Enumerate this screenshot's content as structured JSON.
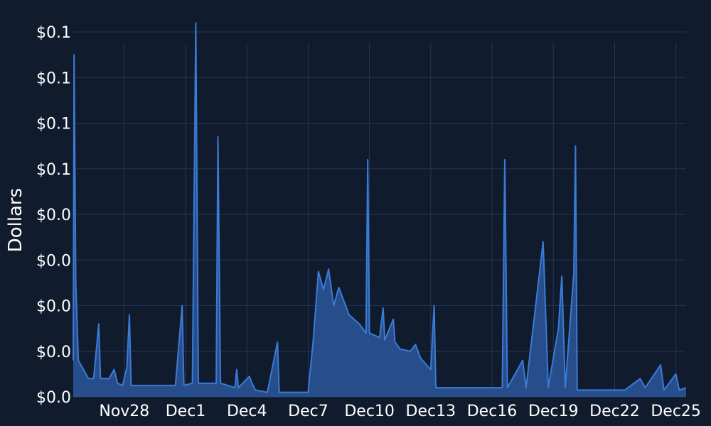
{
  "colors": {
    "background": "#111b2e",
    "grid": "#26365a",
    "line": "#3a7bd5",
    "fill": "#2b579a",
    "text": "#ffffff"
  },
  "chart_data": {
    "type": "area",
    "title": "",
    "xlabel": "",
    "ylabel": "Dollars",
    "grid": true,
    "legend": "none",
    "x_tick_labels": [
      "Nov28",
      "Dec1",
      "Dec4",
      "Dec7",
      "Dec10",
      "Dec13",
      "Dec16",
      "Dec19",
      "Dec22",
      "Dec25"
    ],
    "y_tick_labels": [
      "$0.0",
      "$0.0",
      "$0.0",
      "$0.0",
      "$0.0",
      "$0.1",
      "$0.1",
      "$0.1",
      "$0.1"
    ],
    "y_tick_values": [
      0,
      0.02,
      0.04,
      0.06,
      0.08,
      0.1,
      0.12,
      0.14,
      0.16
    ],
    "xlim": [
      "Nov 25 12:00",
      "Dec 25 12:00"
    ],
    "ylim": [
      0,
      0.16
    ],
    "series": [
      {
        "points": [
          [
            "Nov 25 12:00",
            0.016
          ],
          [
            "Nov 25 13:00",
            0.15
          ],
          [
            "Nov 25 15:00",
            0.05
          ],
          [
            "Nov 25 18:00",
            0.016
          ],
          [
            "Nov 26 06:00",
            0.008
          ],
          [
            "Nov 26 12:00",
            0.008
          ],
          [
            "Nov 26 18:00",
            0.032
          ],
          [
            "Nov 26 20:00",
            0.008
          ],
          [
            "Nov 27 06:00",
            0.008
          ],
          [
            "Nov 27 12:00",
            0.012
          ],
          [
            "Nov 27 16:00",
            0.006
          ],
          [
            "Nov 27 22:00",
            0.005
          ],
          [
            "Nov 28 03:00",
            0.013
          ],
          [
            "Nov 28 06:00",
            0.036
          ],
          [
            "Nov 28 08:00",
            0.005
          ],
          [
            "Nov 28 18:00",
            0.005
          ],
          [
            "Nov 29 12:00",
            0.005
          ],
          [
            "Nov 30 12:00",
            0.005
          ],
          [
            "Nov 30 20:00",
            0.04
          ],
          [
            "Nov 30 22:00",
            0.005
          ],
          [
            "Dec 1 08:00",
            0.006
          ],
          [
            "Dec 1 12:00",
            0.164
          ],
          [
            "Dec 1 15:00",
            0.006
          ],
          [
            "Dec 2 12:00",
            0.006
          ],
          [
            "Dec 2 14:00",
            0.114
          ],
          [
            "Dec 2 17:00",
            0.006
          ],
          [
            "Dec 3 10:00",
            0.004
          ],
          [
            "Dec 3 12:00",
            0.012
          ],
          [
            "Dec 3 14:00",
            0.004
          ],
          [
            "Dec 4 03:00",
            0.009
          ],
          [
            "Dec 4 06:00",
            0.006
          ],
          [
            "Dec 4 10:00",
            0.003
          ],
          [
            "Dec 5 00:00",
            0.002
          ],
          [
            "Dec 5 12:00",
            0.024
          ],
          [
            "Dec 5 14:00",
            0.002
          ],
          [
            "Dec 6 12:00",
            0.002
          ],
          [
            "Dec 7 00:00",
            0.002
          ],
          [
            "Dec 7 06:00",
            0.025
          ],
          [
            "Dec 7 12:00",
            0.055
          ],
          [
            "Dec 7 18:00",
            0.047
          ],
          [
            "Dec 8 00:00",
            0.056
          ],
          [
            "Dec 8 06:00",
            0.04
          ],
          [
            "Dec 8 12:00",
            0.048
          ],
          [
            "Dec 8 18:00",
            0.042
          ],
          [
            "Dec 9 00:00",
            0.036
          ],
          [
            "Dec 9 12:00",
            0.032
          ],
          [
            "Dec 9 20:00",
            0.028
          ],
          [
            "Dec 9 22:00",
            0.104
          ],
          [
            "Dec 10 00:00",
            0.028
          ],
          [
            "Dec 10 12:00",
            0.026
          ],
          [
            "Dec 10 16:00",
            0.039
          ],
          [
            "Dec 10 18:00",
            0.025
          ],
          [
            "Dec 11 04:00",
            0.034
          ],
          [
            "Dec 11 06:00",
            0.024
          ],
          [
            "Dec 11 12:00",
            0.021
          ],
          [
            "Dec 12 00:00",
            0.02
          ],
          [
            "Dec 12 06:00",
            0.023
          ],
          [
            "Dec 12 12:00",
            0.017
          ],
          [
            "Dec 13 00:00",
            0.012
          ],
          [
            "Dec 13 04:00",
            0.04
          ],
          [
            "Dec 13 06:00",
            0.004
          ],
          [
            "Dec 14 12:00",
            0.004
          ],
          [
            "Dec 15 12:00",
            0.004
          ],
          [
            "Dec 16 12:00",
            0.004
          ],
          [
            "Dec 16 15:00",
            0.104
          ],
          [
            "Dec 16 18:00",
            0.004
          ],
          [
            "Dec 17 12:00",
            0.016
          ],
          [
            "Dec 17 16:00",
            0.004
          ],
          [
            "Dec 18 12:00",
            0.068
          ],
          [
            "Dec 18 18:00",
            0.004
          ],
          [
            "Dec 19 06:00",
            0.03
          ],
          [
            "Dec 19 10:00",
            0.053
          ],
          [
            "Dec 19 14:00",
            0.004
          ],
          [
            "Dec 20 00:00",
            0.054
          ],
          [
            "Dec 20 02:00",
            0.11
          ],
          [
            "Dec 20 04:00",
            0.003
          ],
          [
            "Dec 21 12:00",
            0.003
          ],
          [
            "Dec 22 12:00",
            0.003
          ],
          [
            "Dec 23 06:00",
            0.008
          ],
          [
            "Dec 23 12:00",
            0.004
          ],
          [
            "Dec 24 06:00",
            0.014
          ],
          [
            "Dec 24 10:00",
            0.003
          ],
          [
            "Dec 25 00:00",
            0.01
          ],
          [
            "Dec 25 04:00",
            0.003
          ],
          [
            "Dec 25 12:00",
            0.004
          ]
        ]
      }
    ]
  }
}
